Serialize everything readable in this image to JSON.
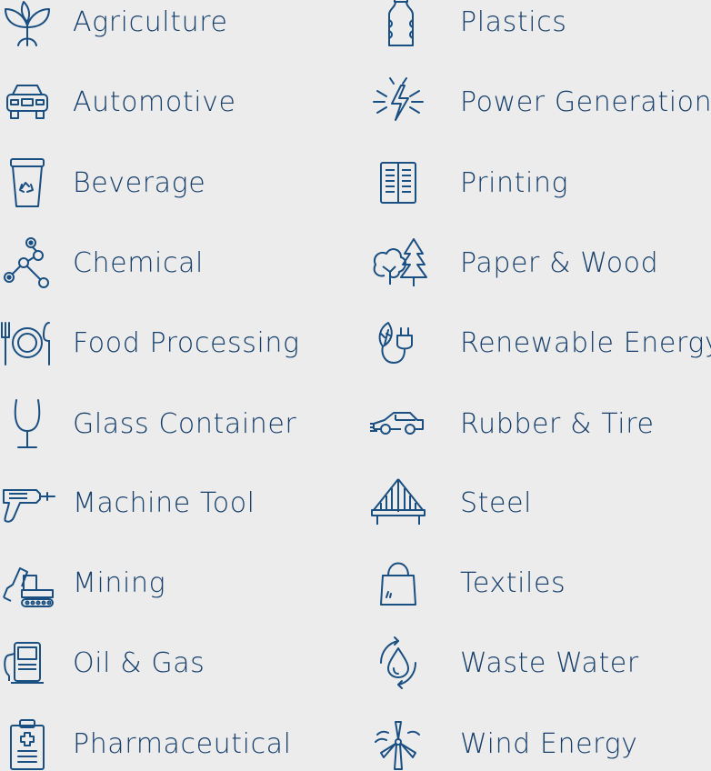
{
  "colors": {
    "icon": "#1a4f82",
    "text": "#163f6b",
    "background": "#ececec"
  },
  "left_column": [
    {
      "label": "Agriculture",
      "icon": "plant-sprout-icon"
    },
    {
      "label": "Automotive",
      "icon": "car-front-icon"
    },
    {
      "label": "Beverage",
      "icon": "recycling-cup-icon"
    },
    {
      "label": "Chemical",
      "icon": "molecule-icon"
    },
    {
      "label": "Food Processing",
      "icon": "plate-cutlery-icon"
    },
    {
      "label": "Glass Container",
      "icon": "wine-glass-icon"
    },
    {
      "label": "Machine Tool",
      "icon": "drill-icon"
    },
    {
      "label": "Mining",
      "icon": "excavator-icon"
    },
    {
      "label": "Oil & Gas",
      "icon": "fuel-pump-icon"
    },
    {
      "label": "Pharmaceutical",
      "icon": "medical-clipboard-icon"
    }
  ],
  "right_column": [
    {
      "label": "Plastics",
      "icon": "plastic-bottle-icon"
    },
    {
      "label": "Power Generation",
      "icon": "lightning-burst-icon"
    },
    {
      "label": "Printing",
      "icon": "open-book-icon"
    },
    {
      "label": "Paper & Wood",
      "icon": "trees-icon"
    },
    {
      "label": "Renewable Energy",
      "icon": "leaf-plug-icon"
    },
    {
      "label": "Rubber & Tire",
      "icon": "car-side-icon"
    },
    {
      "label": "Steel",
      "icon": "suspension-bridge-icon"
    },
    {
      "label": "Textiles",
      "icon": "shopping-bag-icon"
    },
    {
      "label": "Waste Water",
      "icon": "water-drop-cycle-icon"
    },
    {
      "label": "Wind Energy",
      "icon": "wind-turbine-icon"
    }
  ]
}
